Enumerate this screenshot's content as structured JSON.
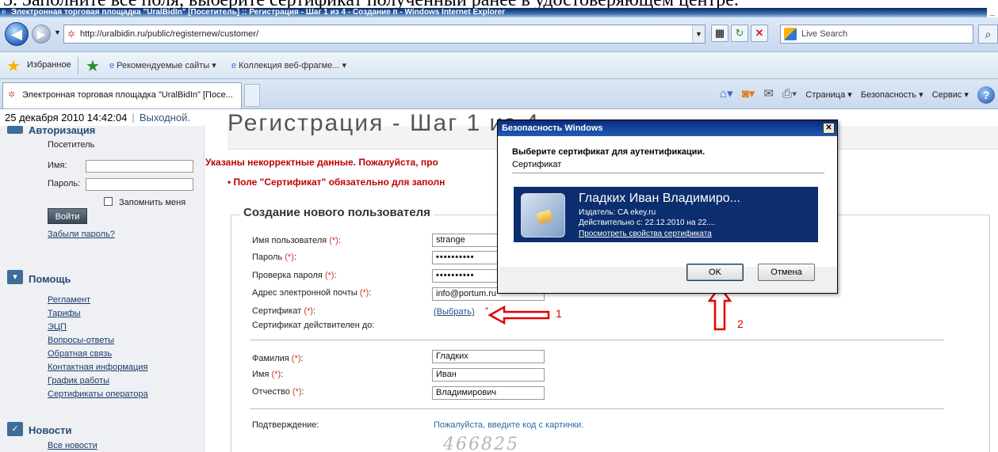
{
  "doc_caption": "3. Заполните все поля, выберите сертификат полученный ранее в удостоверяющем центре.",
  "browser": {
    "title": "Электронная торговая площадка \"UralBidIn\" [Посетитель] :: Регистрация - Шаг 1 из 4 - Создание п - Windows Internet Explorer",
    "url": "http://uralbidin.ru/public/registernew/customer/",
    "search_placeholder": "Live Search",
    "favorites_label": "Избранное",
    "fav_items": [
      "Рекомендуемые сайты ▾",
      "Коллекция веб-фрагме... ▾"
    ],
    "tab_title": "Электронная торговая площадка \"UralBidIn\" [Посе...",
    "commands": [
      "Страница ▾",
      "Безопасность ▾",
      "Сервис ▾"
    ]
  },
  "status": {
    "datetime": "25 декабря 2010 14:42:04",
    "day_status": "Выходной."
  },
  "sidebar": {
    "auth_header": "Авторизация",
    "visitor": "Посетитель",
    "name_label": "Имя:",
    "password_label": "Пароль:",
    "remember_label": "Запомнить меня",
    "login_button": "Войти",
    "forgot_link": "Забыли пароль?",
    "help_header": "Помощь",
    "help_links": [
      "Регламент",
      "Тарифы",
      "ЭЦП",
      "Вопросы-ответы",
      "Обратная связь",
      "Контактная информация",
      "График работы",
      "Сертификаты оператора"
    ],
    "news_header": "Новости",
    "news_link": "Все новости"
  },
  "main": {
    "heading": "Регистрация - Шаг 1 из 4",
    "error_title": "Указаны некорректные данные. Пожалуйста, про",
    "error_item": "•  Поле \"Сертификат\" обязательно для заполн",
    "legend": "Создание нового пользователя",
    "required_mark": "(*)",
    "fields": {
      "username_label": "Имя пользователя",
      "username_value": "strange",
      "password_label": "Пароль",
      "password_value": "••••••••••",
      "password2_label": "Проверка пароля",
      "password2_value": "••••••••••",
      "email_label": "Адрес электронной почты",
      "email_value": "info@portum.ru",
      "cert_label": "Сертификат",
      "cert_pick": "(Выбрать)",
      "cert_valid_label": "Сертификат действителен до:",
      "surname_label": "Фамилия",
      "surname_value": "Гладких",
      "firstname_label": "Имя",
      "firstname_value": "Иван",
      "patronymic_label": "Отчество",
      "patronymic_value": "Владимирович",
      "confirm_label": "Подтверждение:",
      "captcha_hint": "Пожалуйста, введите код с картинки.",
      "captcha_code": "466825"
    }
  },
  "dialog": {
    "title": "Безопасность Windows",
    "question": "Выберите сертификат для аутентификации.",
    "subtitle": "Сертификат",
    "cert_name": "Гладких Иван Владимиро...",
    "cert_issuer": "Издатель: CA ekey.ru",
    "cert_valid": "Действительно с: 22.12.2010 на 22....",
    "cert_link": "Просмотреть свойства сертификата",
    "ok": "OK",
    "cancel": "Отмена"
  },
  "annotations": {
    "one": "1",
    "two": "2"
  },
  "colors": {
    "error": "#c00000",
    "annotation": "#e00000",
    "dialog_tile": "#0c2e6e"
  }
}
